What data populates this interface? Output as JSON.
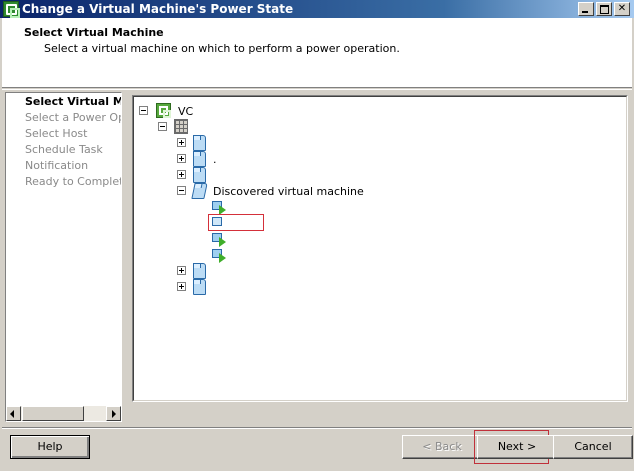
{
  "window": {
    "title": "Change a Virtual Machine's Power State",
    "controls": [
      "minimize",
      "maximize",
      "close"
    ]
  },
  "header": {
    "title": "Select Virtual Machine",
    "subtitle": "Select a virtual machine on which to perform a power operation."
  },
  "steps": [
    {
      "label": "Select Virtual Ma",
      "active": true
    },
    {
      "label": "Select a Power Oper",
      "active": false
    },
    {
      "label": "Select Host",
      "active": false
    },
    {
      "label": "Schedule Task",
      "active": false
    },
    {
      "label": "Notification",
      "active": false
    },
    {
      "label": "Ready to Complete",
      "active": false
    }
  ],
  "tree": {
    "root_label": "VC",
    "datacenter_label": "",
    "folders": [
      {
        "label": ""
      },
      {
        "label": "."
      },
      {
        "label": ""
      },
      {
        "label": "Discovered virtual machine",
        "expanded": true
      },
      {
        "label": ""
      },
      {
        "label": ""
      }
    ],
    "vms": [
      {
        "label": "",
        "power": "on"
      },
      {
        "label": "",
        "power": "off",
        "highlighted": true
      },
      {
        "label": "",
        "power": "on"
      },
      {
        "label": "",
        "power": "on"
      }
    ]
  },
  "buttons": {
    "help": "Help",
    "back": "< Back",
    "next": "Next >",
    "cancel": "Cancel"
  },
  "colors": {
    "title_gradient_start": "#0a246a",
    "title_gradient_end": "#a6caf0",
    "highlight": "#d4303a",
    "vm_power_on": "#3fae2a"
  }
}
